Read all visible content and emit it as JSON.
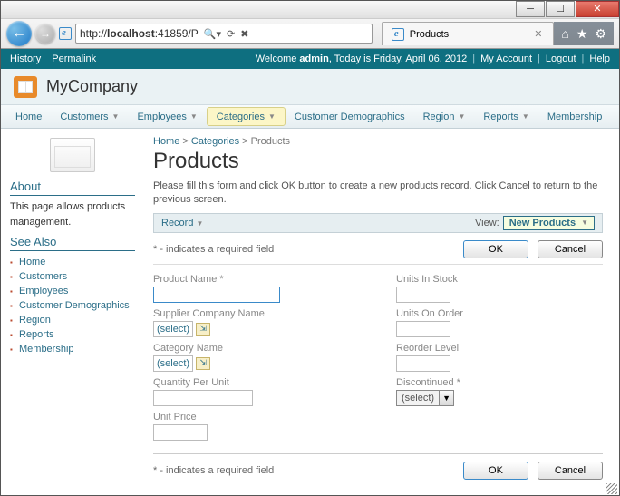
{
  "window": {
    "url_prefix": "http://",
    "url_host": "localhost",
    "url_rest": ":41859/P",
    "tab_title": "Products"
  },
  "topbar": {
    "history": "History",
    "permalink": "Permalink",
    "welcome_pre": "Welcome ",
    "welcome_user": "admin",
    "welcome_post": ", Today is Friday, April 06, 2012",
    "my_account": "My Account",
    "logout": "Logout",
    "help": "Help"
  },
  "brand": {
    "company": "MyCompany"
  },
  "tabs": {
    "home": "Home",
    "customers": "Customers",
    "employees": "Employees",
    "categories": "Categories",
    "custdemo": "Customer Demographics",
    "region": "Region",
    "reports": "Reports",
    "membership": "Membership"
  },
  "sidebar": {
    "about_h": "About",
    "about_body": "This page allows products management.",
    "seealso_h": "See Also",
    "links": [
      "Home",
      "Customers",
      "Employees",
      "Customer Demographics",
      "Region",
      "Reports",
      "Membership"
    ]
  },
  "content": {
    "bc_home": "Home",
    "bc_cat": "Categories",
    "bc_prod": "Products",
    "title": "Products",
    "desc": "Please fill this form and click OK button to create a new products record. Click Cancel to return to the previous screen.",
    "record": "Record",
    "view_label": "View:",
    "view_value": "New Products",
    "req_note": "* - indicates a required field",
    "ok": "OK",
    "cancel": "Cancel",
    "select_text": "(select)"
  },
  "fields": {
    "product_name": "Product Name",
    "units_in_stock": "Units In Stock",
    "supplier": "Supplier Company Name",
    "units_on_order": "Units On Order",
    "category": "Category Name",
    "reorder": "Reorder Level",
    "qty": "Quantity Per Unit",
    "discontinued": "Discontinued",
    "unit_price": "Unit Price"
  }
}
